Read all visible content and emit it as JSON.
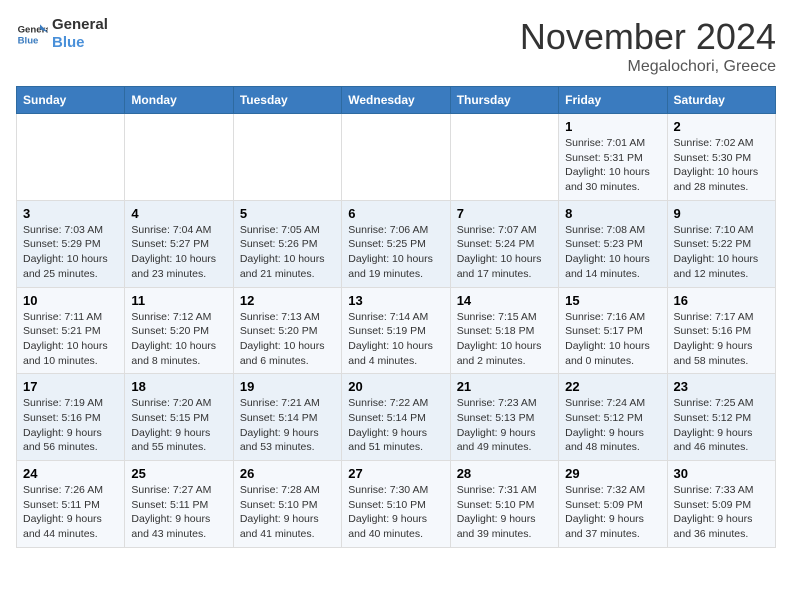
{
  "header": {
    "logo_line1": "General",
    "logo_line2": "Blue",
    "month": "November 2024",
    "location": "Megalochori, Greece"
  },
  "weekdays": [
    "Sunday",
    "Monday",
    "Tuesday",
    "Wednesday",
    "Thursday",
    "Friday",
    "Saturday"
  ],
  "weeks": [
    [
      {
        "day": "",
        "info": ""
      },
      {
        "day": "",
        "info": ""
      },
      {
        "day": "",
        "info": ""
      },
      {
        "day": "",
        "info": ""
      },
      {
        "day": "",
        "info": ""
      },
      {
        "day": "1",
        "info": "Sunrise: 7:01 AM\nSunset: 5:31 PM\nDaylight: 10 hours and 30 minutes."
      },
      {
        "day": "2",
        "info": "Sunrise: 7:02 AM\nSunset: 5:30 PM\nDaylight: 10 hours and 28 minutes."
      }
    ],
    [
      {
        "day": "3",
        "info": "Sunrise: 7:03 AM\nSunset: 5:29 PM\nDaylight: 10 hours and 25 minutes."
      },
      {
        "day": "4",
        "info": "Sunrise: 7:04 AM\nSunset: 5:27 PM\nDaylight: 10 hours and 23 minutes."
      },
      {
        "day": "5",
        "info": "Sunrise: 7:05 AM\nSunset: 5:26 PM\nDaylight: 10 hours and 21 minutes."
      },
      {
        "day": "6",
        "info": "Sunrise: 7:06 AM\nSunset: 5:25 PM\nDaylight: 10 hours and 19 minutes."
      },
      {
        "day": "7",
        "info": "Sunrise: 7:07 AM\nSunset: 5:24 PM\nDaylight: 10 hours and 17 minutes."
      },
      {
        "day": "8",
        "info": "Sunrise: 7:08 AM\nSunset: 5:23 PM\nDaylight: 10 hours and 14 minutes."
      },
      {
        "day": "9",
        "info": "Sunrise: 7:10 AM\nSunset: 5:22 PM\nDaylight: 10 hours and 12 minutes."
      }
    ],
    [
      {
        "day": "10",
        "info": "Sunrise: 7:11 AM\nSunset: 5:21 PM\nDaylight: 10 hours and 10 minutes."
      },
      {
        "day": "11",
        "info": "Sunrise: 7:12 AM\nSunset: 5:20 PM\nDaylight: 10 hours and 8 minutes."
      },
      {
        "day": "12",
        "info": "Sunrise: 7:13 AM\nSunset: 5:20 PM\nDaylight: 10 hours and 6 minutes."
      },
      {
        "day": "13",
        "info": "Sunrise: 7:14 AM\nSunset: 5:19 PM\nDaylight: 10 hours and 4 minutes."
      },
      {
        "day": "14",
        "info": "Sunrise: 7:15 AM\nSunset: 5:18 PM\nDaylight: 10 hours and 2 minutes."
      },
      {
        "day": "15",
        "info": "Sunrise: 7:16 AM\nSunset: 5:17 PM\nDaylight: 10 hours and 0 minutes."
      },
      {
        "day": "16",
        "info": "Sunrise: 7:17 AM\nSunset: 5:16 PM\nDaylight: 9 hours and 58 minutes."
      }
    ],
    [
      {
        "day": "17",
        "info": "Sunrise: 7:19 AM\nSunset: 5:16 PM\nDaylight: 9 hours and 56 minutes."
      },
      {
        "day": "18",
        "info": "Sunrise: 7:20 AM\nSunset: 5:15 PM\nDaylight: 9 hours and 55 minutes."
      },
      {
        "day": "19",
        "info": "Sunrise: 7:21 AM\nSunset: 5:14 PM\nDaylight: 9 hours and 53 minutes."
      },
      {
        "day": "20",
        "info": "Sunrise: 7:22 AM\nSunset: 5:14 PM\nDaylight: 9 hours and 51 minutes."
      },
      {
        "day": "21",
        "info": "Sunrise: 7:23 AM\nSunset: 5:13 PM\nDaylight: 9 hours and 49 minutes."
      },
      {
        "day": "22",
        "info": "Sunrise: 7:24 AM\nSunset: 5:12 PM\nDaylight: 9 hours and 48 minutes."
      },
      {
        "day": "23",
        "info": "Sunrise: 7:25 AM\nSunset: 5:12 PM\nDaylight: 9 hours and 46 minutes."
      }
    ],
    [
      {
        "day": "24",
        "info": "Sunrise: 7:26 AM\nSunset: 5:11 PM\nDaylight: 9 hours and 44 minutes."
      },
      {
        "day": "25",
        "info": "Sunrise: 7:27 AM\nSunset: 5:11 PM\nDaylight: 9 hours and 43 minutes."
      },
      {
        "day": "26",
        "info": "Sunrise: 7:28 AM\nSunset: 5:10 PM\nDaylight: 9 hours and 41 minutes."
      },
      {
        "day": "27",
        "info": "Sunrise: 7:30 AM\nSunset: 5:10 PM\nDaylight: 9 hours and 40 minutes."
      },
      {
        "day": "28",
        "info": "Sunrise: 7:31 AM\nSunset: 5:10 PM\nDaylight: 9 hours and 39 minutes."
      },
      {
        "day": "29",
        "info": "Sunrise: 7:32 AM\nSunset: 5:09 PM\nDaylight: 9 hours and 37 minutes."
      },
      {
        "day": "30",
        "info": "Sunrise: 7:33 AM\nSunset: 5:09 PM\nDaylight: 9 hours and 36 minutes."
      }
    ]
  ]
}
